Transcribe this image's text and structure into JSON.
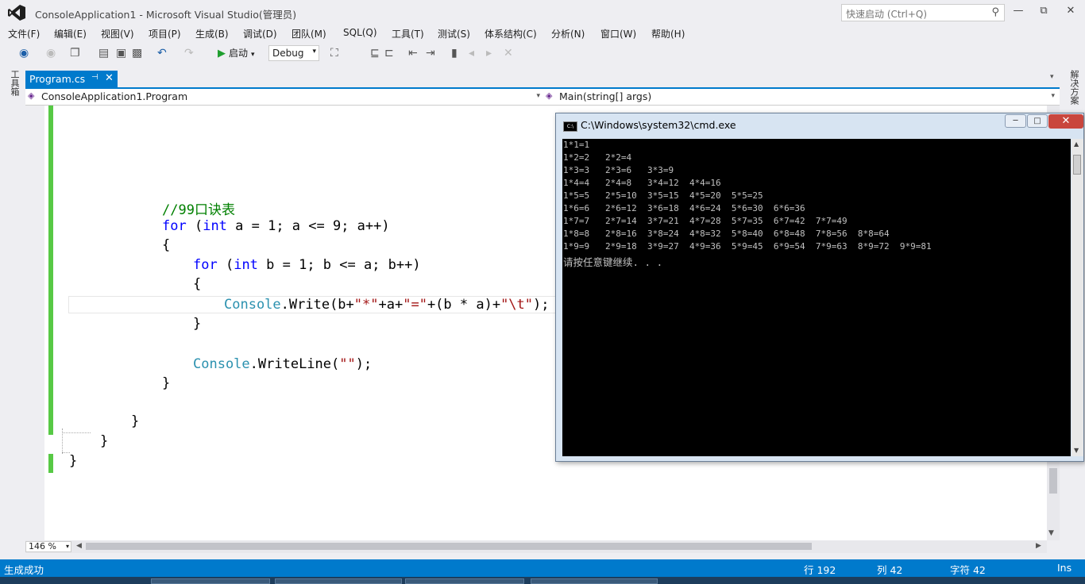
{
  "window": {
    "title": "ConsoleApplication1 - Microsoft Visual Studio(管理员)",
    "quick_launch_placeholder": "快速启动 (Ctrl+Q)",
    "min": "—",
    "max": "⧉",
    "close": "✕"
  },
  "menu": [
    "文件(F)",
    "编辑(E)",
    "视图(V)",
    "项目(P)",
    "生成(B)",
    "调试(D)",
    "团队(M)",
    "SQL(Q)",
    "工具(T)",
    "测试(S)",
    "体系结构(C)",
    "分析(N)",
    "窗口(W)",
    "帮助(H)"
  ],
  "toolbar": {
    "start_label": "启动",
    "config_value": "Debug"
  },
  "side_panels": {
    "left": "工具箱",
    "right": "解决方案"
  },
  "tab": {
    "label": "Program.cs",
    "pin": "⊣",
    "close": "✕"
  },
  "navbar": {
    "left": "ConsoleApplication1.Program",
    "right": "Main(string[] args)"
  },
  "code_lines": {
    "comment": "//99口诀表",
    "for1_kw": "for",
    "for1_a": " (",
    "for1_int": "int",
    "for1_b": " a = 1; a <= 9; a++)",
    "brace_open1": "{",
    "for2_kw": "for",
    "for2_a": " (",
    "for2_int": "int",
    "for2_b": " b = 1; b <= a; b++)",
    "brace_open2": "{",
    "write_type": "Console",
    "write_a": ".Write(b+",
    "write_s1": "\"*\"",
    "write_b": "+a+",
    "write_s2": "\"=\"",
    "write_c": "+(b * a)+",
    "write_s3": "\"\\t\"",
    "write_d": ");",
    "brace_close2": "}",
    "wl_type": "Console",
    "wl_a": ".WriteLine(",
    "wl_s": "\"\"",
    "wl_b": ");",
    "brace_close1": "}",
    "brace_close_method": "}",
    "brace_close_class": "}",
    "brace_close_ns": "}"
  },
  "zoom": "146 %",
  "status": {
    "message": "生成成功",
    "line": "行 192",
    "col": "列 42",
    "char": "字符 42",
    "mode": "Ins"
  },
  "cmd": {
    "title": "C:\\Windows\\system32\\cmd.exe",
    "icon_text": "C:\\",
    "min": "─",
    "max": "□",
    "close": "✕",
    "lines": [
      "1*1=1",
      "1*2=2   2*2=4",
      "1*3=3   2*3=6   3*3=9",
      "1*4=4   2*4=8   3*4=12  4*4=16",
      "1*5=5   2*5=10  3*5=15  4*5=20  5*5=25",
      "1*6=6   2*6=12  3*6=18  4*6=24  5*6=30  6*6=36",
      "1*7=7   2*7=14  3*7=21  4*7=28  5*7=35  6*7=42  7*7=49",
      "1*8=8   2*8=16  3*8=24  4*8=32  5*8=40  6*8=48  7*8=56  8*8=64",
      "1*9=9   2*9=18  3*9=27  4*9=36  5*9=45  6*9=54  7*9=63  8*9=72  9*9=81",
      "请按任意键继续. . ."
    ]
  },
  "colors": {
    "accent": "#007acc",
    "keyword": "#0000ff",
    "type": "#2b91af",
    "string": "#a31515",
    "comment": "#008000",
    "change_bar": "#57c945"
  }
}
